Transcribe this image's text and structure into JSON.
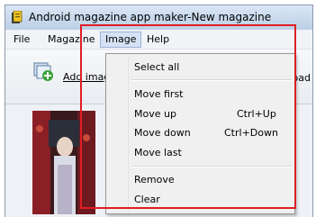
{
  "window": {
    "title": "Android magazine app maker-New magazine"
  },
  "menubar": {
    "items": [
      "File",
      "Magazine",
      "Image",
      "Help"
    ]
  },
  "toolbar": {
    "add_label": "Add imag",
    "right_label": "oad"
  },
  "dropdown": {
    "select_all": "Select all",
    "move_first": "Move first",
    "move_up": "Move up",
    "move_up_shortcut": "Ctrl+Up",
    "move_down": "Move down",
    "move_down_shortcut": "Ctrl+Down",
    "move_last": "Move last",
    "remove": "Remove",
    "clear": "Clear"
  },
  "colors": {
    "highlight_frame": "#e01e24",
    "menu_active": "#d6e2f4"
  }
}
